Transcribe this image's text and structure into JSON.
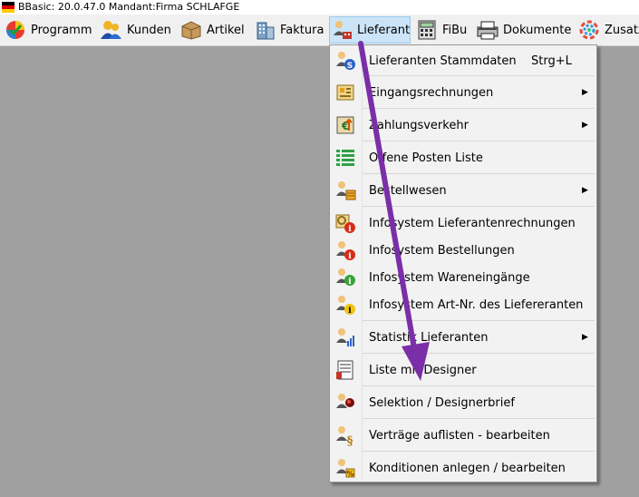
{
  "window": {
    "title": "BBasic: 20.0.47.0 Mandant:Firma SCHLAFGE"
  },
  "menubar": {
    "items": [
      {
        "label": "Programm",
        "icon": "check-globe-icon"
      },
      {
        "label": "Kunden",
        "icon": "customers-icon"
      },
      {
        "label": "Artikel",
        "icon": "box-icon"
      },
      {
        "label": "Faktura",
        "icon": "building-icon"
      },
      {
        "label": "Lieferant",
        "icon": "supplier-icon",
        "active": true
      },
      {
        "label": "FiBu",
        "icon": "calculator-icon"
      },
      {
        "label": "Dokumente",
        "icon": "printer-icon"
      },
      {
        "label": "Zusatzp",
        "icon": "color-wheel-icon"
      }
    ]
  },
  "dropdown": {
    "items": [
      {
        "label": "Lieferanten Stammdaten",
        "shortcut": "Strg+L",
        "icon": "supplier-master-icon",
        "submenu": false
      },
      {
        "label": "Eingangsrechnungen",
        "shortcut": "",
        "icon": "invoice-icon",
        "submenu": true
      },
      {
        "label": "Zahlungsverkehr",
        "shortcut": "",
        "icon": "payment-icon",
        "submenu": true
      },
      {
        "label": "Offene Posten Liste",
        "shortcut": "",
        "icon": "list-icon",
        "submenu": false
      },
      {
        "label": "Bestellwesen",
        "shortcut": "",
        "icon": "order-icon",
        "submenu": true
      },
      {
        "label": "Infosystem Lieferantenrechnungen",
        "shortcut": "",
        "icon": "info-invoices-icon",
        "submenu": false
      },
      {
        "label": "Infosystem Bestellungen",
        "shortcut": "",
        "icon": "info-orders-icon",
        "submenu": false
      },
      {
        "label": "Infosystem Wareneingänge",
        "shortcut": "",
        "icon": "info-goods-icon",
        "submenu": false
      },
      {
        "label": "Infosystem Art-Nr. des Liefereranten",
        "shortcut": "",
        "icon": "info-article-icon",
        "submenu": false
      },
      {
        "label": "Statistik Lieferanten",
        "shortcut": "",
        "icon": "statistics-icon",
        "submenu": true
      },
      {
        "label": "Liste mit Designer",
        "shortcut": "",
        "icon": "designer-list-icon",
        "submenu": false
      },
      {
        "label": "Selektion / Designerbrief",
        "shortcut": "",
        "icon": "selection-icon",
        "submenu": false
      },
      {
        "label": "Verträge auflisten - bearbeiten",
        "shortcut": "",
        "icon": "contracts-icon",
        "submenu": false
      },
      {
        "label": "Konditionen anlegen / bearbeiten",
        "shortcut": "",
        "icon": "conditions-icon",
        "submenu": false
      }
    ]
  },
  "colors": {
    "arrow": "#7a2fa8",
    "menu_highlight": "#cce4f7",
    "desktop": "#a0a0a0"
  }
}
